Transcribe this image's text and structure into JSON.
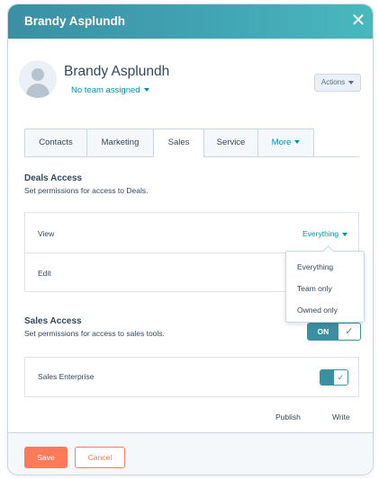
{
  "header": {
    "title": "Brandy Asplundh",
    "close_icon": "close-icon"
  },
  "user": {
    "name": "Brandy Asplundh",
    "team_label": "No team assigned"
  },
  "actions": {
    "label": "Actions"
  },
  "tabs": [
    {
      "label": "Contacts",
      "active": false
    },
    {
      "label": "Marketing",
      "active": false
    },
    {
      "label": "Sales",
      "active": true
    },
    {
      "label": "Service",
      "active": false
    },
    {
      "label": "More",
      "active": false
    }
  ],
  "deals": {
    "title": "Deals Access",
    "description": "Set permissions for access to Deals.",
    "view_label": "View",
    "view_value": "Everything",
    "edit_label": "Edit"
  },
  "dropdown": {
    "options": [
      "Everything",
      "Team only",
      "Owned only"
    ]
  },
  "sales_access": {
    "title": "Sales Access",
    "description": "Set permissions for access to sales tools.",
    "toggle_label": "ON",
    "toggle_state": "on"
  },
  "sales_enterprise": {
    "label": "Sales Enterprise",
    "toggle_state": "on"
  },
  "columns": {
    "publish": "Publish",
    "write": "Write"
  },
  "footer": {
    "save_label": "Save",
    "cancel_label": "Cancel"
  },
  "colors": {
    "accent": "#3b8fa3",
    "link": "#0091ae",
    "primary_button": "#ff7a59",
    "text": "#33475b"
  }
}
